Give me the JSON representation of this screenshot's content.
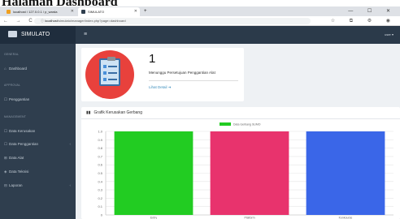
{
  "page_heading": "Halaman Dashboard",
  "browser": {
    "tabs": [
      {
        "label": "localhost / 127.0.0.1 / p_warda",
        "active": false
      },
      {
        "label": "SIMULATO",
        "active": true
      }
    ],
    "new_tab": "+",
    "window_controls": "— ☐ ✕",
    "nav": "← → C",
    "url_host": "localhost",
    "url_path": "/simulato/manager/index.php?page=dashboard",
    "extensions": "☆ ⧉ ⚙ ◉"
  },
  "app": {
    "brand": "SIMULATO",
    "menu_icon": "≡",
    "user_menu": "user ▾"
  },
  "sidebar": {
    "sections": [
      {
        "title": "GENERAL",
        "items": [
          {
            "icon": "⌂",
            "label": "Dashboard",
            "has_sub": false
          }
        ]
      },
      {
        "title": "APPROVAL",
        "items": [
          {
            "icon": "☐",
            "label": "Penggantian",
            "has_sub": false
          }
        ]
      },
      {
        "title": "MANAGEMENT",
        "items": [
          {
            "icon": "☐",
            "label": "Data Kerusakan",
            "has_sub": false
          },
          {
            "icon": "☐",
            "label": "Data Penggantian",
            "has_sub": true
          },
          {
            "icon": "⊞",
            "label": "Data Alat",
            "has_sub": false
          },
          {
            "icon": "◈",
            "label": "Data Teknisi",
            "has_sub": false
          },
          {
            "icon": "⊟",
            "label": "Laporan",
            "has_sub": true
          }
        ]
      }
    ]
  },
  "stat_card": {
    "value": "1",
    "label": "Menunggu Persetujuan Penggantian Alat",
    "link": "Lihat Detail ➜"
  },
  "chart_card": {
    "title": "Grafik Kerusakan Gerbang",
    "icon": "bar-chart-icon"
  },
  "chart_data": {
    "type": "bar",
    "categories": [
      "Entry",
      "Platform",
      "Konkourse"
    ],
    "series": [
      {
        "name": "Data Gerbang SUMO",
        "values": [
          1.0,
          1.0,
          1.0
        ]
      }
    ],
    "colors": [
      "#22cc22",
      "#e8336d",
      "#3a66e8"
    ],
    "legend_color": "#22cc22",
    "ylim": [
      0,
      1.0
    ],
    "yticks": [
      "0",
      "0.1",
      "0.2",
      "0.3",
      "0.4",
      "0.5",
      "0.6",
      "0.7",
      "0.8",
      "0.9",
      "1.0"
    ],
    "grid": true,
    "legend_position": "top-center"
  }
}
